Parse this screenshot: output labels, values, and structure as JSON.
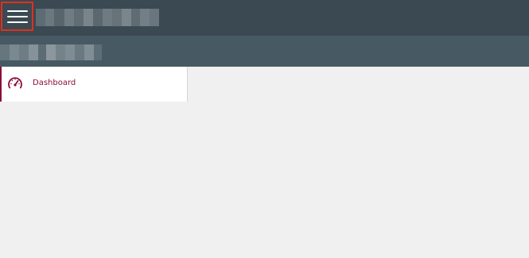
{
  "header": {
    "menu_icon": "hamburger-menu-icon",
    "background": "#3b4952",
    "app_title_pixelated": true,
    "menu_highlight_color": "#e0301e"
  },
  "subheader": {
    "background": "#475a63",
    "title_pixelated": true
  },
  "sidebar": {
    "accent_color": "#8a0e3a",
    "items": [
      {
        "label": "Dashboard",
        "icon": "speedometer-icon",
        "active": true
      }
    ]
  }
}
